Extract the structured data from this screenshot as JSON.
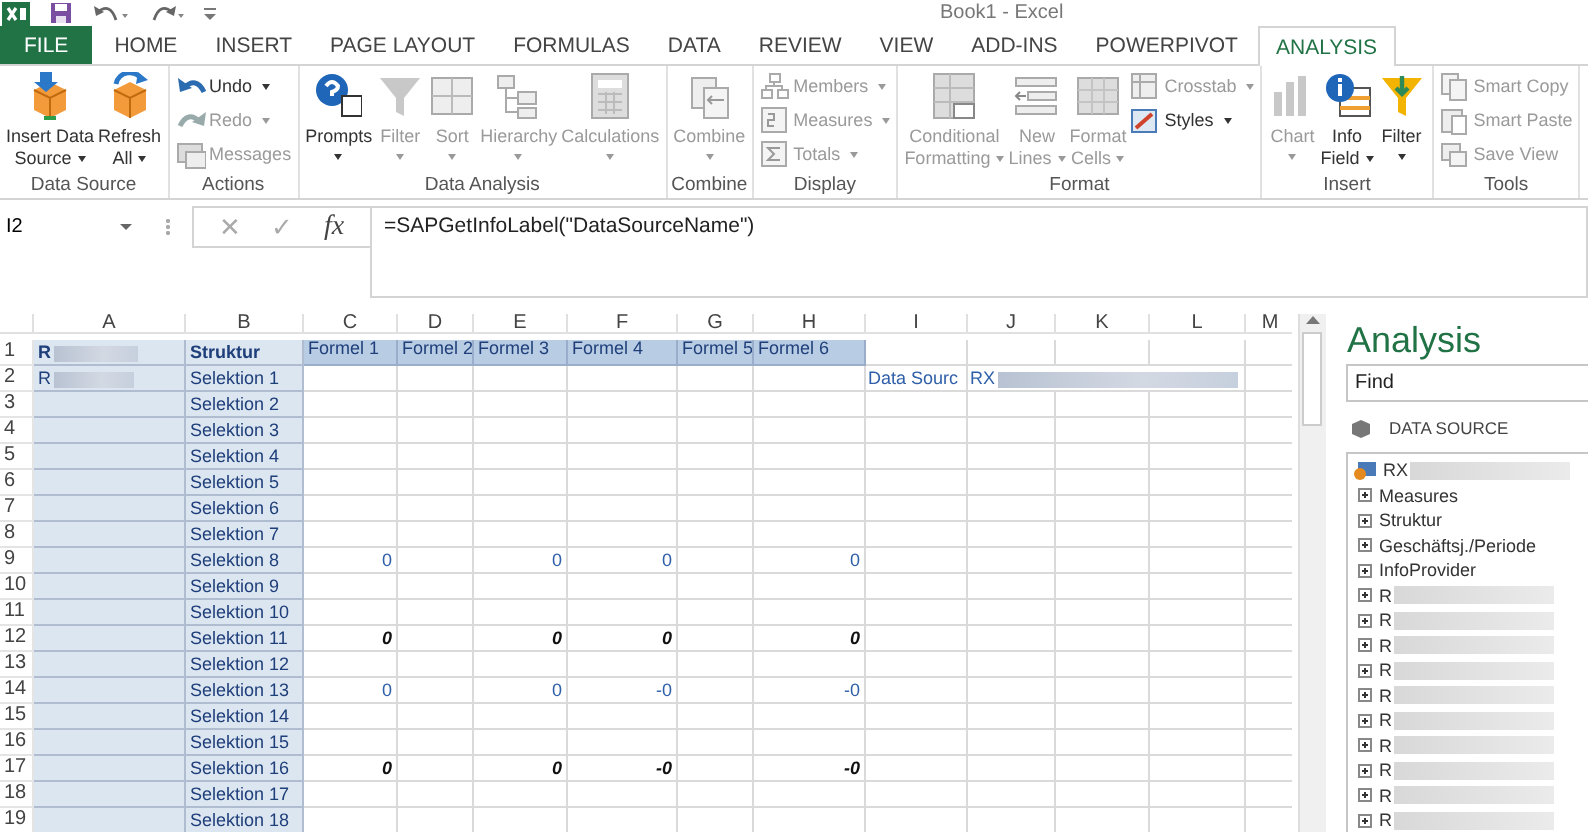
{
  "window": {
    "title": "Book1 - Excel"
  },
  "ribbon": {
    "tabs": [
      {
        "label": "FILE",
        "kind": "file",
        "selected": false
      },
      {
        "label": "HOME",
        "kind": "tab",
        "selected": false
      },
      {
        "label": "INSERT",
        "kind": "tab",
        "selected": false
      },
      {
        "label": "PAGE LAYOUT",
        "kind": "tab",
        "selected": false
      },
      {
        "label": "FORMULAS",
        "kind": "tab",
        "selected": false
      },
      {
        "label": "DATA",
        "kind": "tab",
        "selected": false
      },
      {
        "label": "REVIEW",
        "kind": "tab",
        "selected": false
      },
      {
        "label": "VIEW",
        "kind": "tab",
        "selected": false
      },
      {
        "label": "ADD-INS",
        "kind": "tab",
        "selected": false
      },
      {
        "label": "POWERPIVOT",
        "kind": "tab",
        "selected": false
      },
      {
        "label": "ANALYSIS",
        "kind": "tab",
        "selected": true
      }
    ],
    "groups": [
      {
        "label": "Data Source",
        "items": [
          {
            "kind": "large",
            "lines": [
              "Insert Data",
              "Source"
            ],
            "dropdown": true,
            "disabled": false
          },
          {
            "kind": "large",
            "lines": [
              "Refresh",
              "All"
            ],
            "dropdown": true,
            "disabled": false
          }
        ]
      },
      {
        "label": "Actions",
        "items": [
          {
            "kind": "small",
            "lines": [
              "Undo"
            ],
            "dropdown": true,
            "disabled": false
          },
          {
            "kind": "small",
            "lines": [
              "Redo"
            ],
            "dropdown": true,
            "disabled": true
          },
          {
            "kind": "small",
            "lines": [
              "Messages"
            ],
            "dropdown": false,
            "disabled": true
          }
        ]
      },
      {
        "label": "Data Analysis",
        "items": [
          {
            "kind": "large",
            "lines": [
              "Prompts"
            ],
            "dropdown": true,
            "disabled": false
          },
          {
            "kind": "large",
            "lines": [
              "Filter"
            ],
            "dropdown": true,
            "disabled": true
          },
          {
            "kind": "large",
            "lines": [
              "Sort"
            ],
            "dropdown": true,
            "disabled": true
          },
          {
            "kind": "large",
            "lines": [
              "Hierarchy"
            ],
            "dropdown": true,
            "disabled": true
          },
          {
            "kind": "large",
            "lines": [
              "Calculations"
            ],
            "dropdown": true,
            "disabled": true
          }
        ]
      },
      {
        "label": "Combine",
        "items": [
          {
            "kind": "large",
            "lines": [
              "Combine"
            ],
            "dropdown": true,
            "disabled": true
          }
        ]
      },
      {
        "label": "Display",
        "items": [
          {
            "kind": "small",
            "lines": [
              "Members"
            ],
            "dropdown": true,
            "disabled": true
          },
          {
            "kind": "small",
            "lines": [
              "Measures"
            ],
            "dropdown": true,
            "disabled": true
          },
          {
            "kind": "small",
            "lines": [
              "Totals"
            ],
            "dropdown": true,
            "disabled": true
          }
        ]
      },
      {
        "label": "Format",
        "items": [
          {
            "kind": "large",
            "lines": [
              "Conditional",
              "Formatting"
            ],
            "dropdown": true,
            "disabled": true
          },
          {
            "kind": "large",
            "lines": [
              "New",
              "Lines"
            ],
            "dropdown": true,
            "disabled": true
          },
          {
            "kind": "large",
            "lines": [
              "Format",
              "Cells"
            ],
            "dropdown": true,
            "disabled": true
          },
          {
            "kind": "small",
            "lines": [
              "Crosstab"
            ],
            "dropdown": true,
            "disabled": true
          },
          {
            "kind": "small",
            "lines": [
              "Styles"
            ],
            "dropdown": true,
            "disabled": false
          }
        ]
      },
      {
        "label": "Insert",
        "items": [
          {
            "kind": "large",
            "lines": [
              "Chart"
            ],
            "dropdown": true,
            "disabled": true
          },
          {
            "kind": "large",
            "lines": [
              "Info",
              "Field"
            ],
            "dropdown": true,
            "disabled": false
          },
          {
            "kind": "large",
            "lines": [
              "Filter"
            ],
            "dropdown": true,
            "disabled": false
          }
        ]
      },
      {
        "label": "Tools",
        "items": [
          {
            "kind": "small",
            "lines": [
              "Smart Copy"
            ],
            "dropdown": false,
            "disabled": true
          },
          {
            "kind": "small",
            "lines": [
              "Smart Paste"
            ],
            "dropdown": false,
            "disabled": true
          },
          {
            "kind": "small",
            "lines": [
              "Save View"
            ],
            "dropdown": false,
            "disabled": true
          }
        ]
      }
    ]
  },
  "formula_bar": {
    "name_box": "I2",
    "cancel": "✕",
    "enter": "✓",
    "function": "fx",
    "formula": "=SAPGetInfoLabel(\"DataSourceName\")"
  },
  "sheet": {
    "columns": [
      "A",
      "B",
      "C",
      "D",
      "E",
      "F",
      "G",
      "H",
      "I",
      "J",
      "K",
      "L",
      "M"
    ],
    "rows": [
      {
        "number": "1",
        "cells": {
          "A": {
            "text": "R",
            "redacted": true,
            "italic": false
          },
          "B": {
            "text": "Struktur",
            "redacted": false,
            "italic": false
          },
          "C": {
            "text": "Formel 1",
            "redacted": false,
            "italic": false
          },
          "D": {
            "text": "Formel 2",
            "redacted": false,
            "italic": false
          },
          "E": {
            "text": "Formel 3",
            "redacted": false,
            "italic": false
          },
          "F": {
            "text": "Formel 4",
            "redacted": false,
            "italic": false
          },
          "G": {
            "text": "Formel 5",
            "redacted": false,
            "italic": false
          },
          "H": {
            "text": "Formel 6",
            "redacted": false,
            "italic": false
          }
        }
      },
      {
        "number": "2",
        "cells": {
          "A": {
            "text": "R",
            "redacted": true,
            "italic": false
          },
          "B": {
            "text": "Selektion 1",
            "redacted": false,
            "italic": false
          },
          "I": {
            "text": "Data Sourc",
            "redacted": false,
            "italic": false
          },
          "J": {
            "text": "RX",
            "redacted": true,
            "italic": false
          }
        }
      },
      {
        "number": "3",
        "cells": {
          "B": {
            "text": "Selektion 2",
            "redacted": false,
            "italic": false
          }
        }
      },
      {
        "number": "4",
        "cells": {
          "B": {
            "text": "Selektion 3",
            "redacted": false,
            "italic": false
          }
        }
      },
      {
        "number": "5",
        "cells": {
          "B": {
            "text": "Selektion 4",
            "redacted": false,
            "italic": false
          }
        }
      },
      {
        "number": "6",
        "cells": {
          "B": {
            "text": "Selektion 5",
            "redacted": false,
            "italic": false
          }
        }
      },
      {
        "number": "7",
        "cells": {
          "B": {
            "text": "Selektion 6",
            "redacted": false,
            "italic": false
          }
        }
      },
      {
        "number": "8",
        "cells": {
          "B": {
            "text": "Selektion 7",
            "redacted": false,
            "italic": false
          }
        }
      },
      {
        "number": "9",
        "cells": {
          "B": {
            "text": "Selektion 8",
            "redacted": false,
            "italic": false
          },
          "C": {
            "text": "0",
            "redacted": false,
            "italic": false
          },
          "E": {
            "text": "0",
            "redacted": false,
            "italic": false
          },
          "F": {
            "text": "0",
            "redacted": false,
            "italic": false
          },
          "H": {
            "text": "0",
            "redacted": false,
            "italic": false
          }
        }
      },
      {
        "number": "10",
        "cells": {
          "B": {
            "text": "Selektion 9",
            "redacted": false,
            "italic": false
          }
        }
      },
      {
        "number": "11",
        "cells": {
          "B": {
            "text": "Selektion 10",
            "redacted": false,
            "italic": false
          }
        }
      },
      {
        "number": "12",
        "cells": {
          "B": {
            "text": "Selektion 11",
            "redacted": false,
            "italic": false
          },
          "C": {
            "text": "0",
            "redacted": false,
            "italic": true
          },
          "E": {
            "text": "0",
            "redacted": false,
            "italic": true
          },
          "F": {
            "text": "0",
            "redacted": false,
            "italic": true
          },
          "H": {
            "text": "0",
            "redacted": false,
            "italic": true
          }
        }
      },
      {
        "number": "13",
        "cells": {
          "B": {
            "text": "Selektion 12",
            "redacted": false,
            "italic": false
          }
        }
      },
      {
        "number": "14",
        "cells": {
          "B": {
            "text": "Selektion 13",
            "redacted": false,
            "italic": false
          },
          "C": {
            "text": "0",
            "redacted": false,
            "italic": false
          },
          "E": {
            "text": "0",
            "redacted": false,
            "italic": false
          },
          "F": {
            "text": "-0",
            "redacted": false,
            "italic": false
          },
          "H": {
            "text": "-0",
            "redacted": false,
            "italic": false
          }
        }
      },
      {
        "number": "15",
        "cells": {
          "B": {
            "text": "Selektion 14",
            "redacted": false,
            "italic": false
          }
        }
      },
      {
        "number": "16",
        "cells": {
          "B": {
            "text": "Selektion 15",
            "redacted": false,
            "italic": false
          }
        }
      },
      {
        "number": "17",
        "cells": {
          "B": {
            "text": "Selektion 16",
            "redacted": false,
            "italic": false
          },
          "C": {
            "text": "0",
            "redacted": false,
            "italic": true
          },
          "E": {
            "text": "0",
            "redacted": false,
            "italic": true
          },
          "F": {
            "text": "-0",
            "redacted": false,
            "italic": true
          },
          "H": {
            "text": "-0",
            "redacted": false,
            "italic": true
          }
        }
      },
      {
        "number": "18",
        "cells": {
          "B": {
            "text": "Selektion 17",
            "redacted": false,
            "italic": false
          }
        }
      },
      {
        "number": "19",
        "cells": {
          "B": {
            "text": "Selektion 18",
            "redacted": false,
            "italic": false
          }
        }
      }
    ]
  },
  "task_pane": {
    "title": "Analysis",
    "search": {
      "placeholder": "Find"
    },
    "section": "DATA SOURCE",
    "tree": [
      {
        "label": "RX",
        "redacted": true,
        "children": [
          {
            "label": "Measures",
            "redacted": false,
            "expanded": false
          },
          {
            "label": "Struktur",
            "redacted": false,
            "expanded": false
          },
          {
            "label": "Geschäftsj./Periode",
            "redacted": false,
            "expanded": false
          },
          {
            "label": "InfoProvider",
            "redacted": false,
            "expanded": false
          },
          {
            "label": "R",
            "redacted": true,
            "expanded": false
          },
          {
            "label": "R",
            "redacted": true,
            "expanded": false
          },
          {
            "label": "R",
            "redacted": true,
            "expanded": false
          },
          {
            "label": "R",
            "redacted": true,
            "expanded": false
          },
          {
            "label": "R",
            "redacted": true,
            "expanded": false
          },
          {
            "label": "R",
            "redacted": true,
            "expanded": false
          },
          {
            "label": "R",
            "redacted": true,
            "expanded": false
          },
          {
            "label": "R",
            "redacted": true,
            "expanded": false
          },
          {
            "label": "R",
            "redacted": true,
            "expanded": false
          },
          {
            "label": "R",
            "redacted": true,
            "expanded": false
          }
        ]
      }
    ]
  }
}
